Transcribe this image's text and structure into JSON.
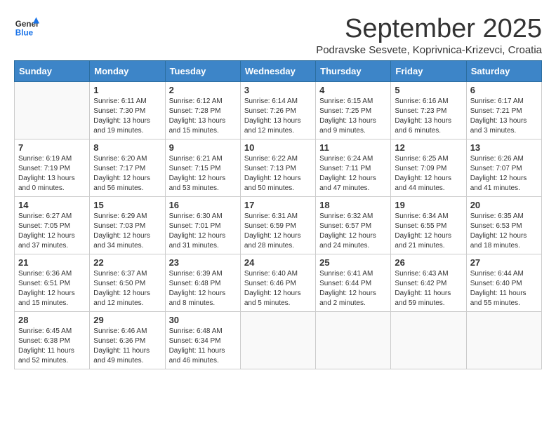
{
  "header": {
    "logo_line1": "General",
    "logo_line2": "Blue",
    "month": "September 2025",
    "location": "Podravske Sesvete, Koprivnica-Krizevci, Croatia"
  },
  "days_of_week": [
    "Sunday",
    "Monday",
    "Tuesday",
    "Wednesday",
    "Thursday",
    "Friday",
    "Saturday"
  ],
  "weeks": [
    [
      {
        "day": "",
        "sunrise": "",
        "sunset": "",
        "daylight": ""
      },
      {
        "day": "1",
        "sunrise": "Sunrise: 6:11 AM",
        "sunset": "Sunset: 7:30 PM",
        "daylight": "Daylight: 13 hours and 19 minutes."
      },
      {
        "day": "2",
        "sunrise": "Sunrise: 6:12 AM",
        "sunset": "Sunset: 7:28 PM",
        "daylight": "Daylight: 13 hours and 15 minutes."
      },
      {
        "day": "3",
        "sunrise": "Sunrise: 6:14 AM",
        "sunset": "Sunset: 7:26 PM",
        "daylight": "Daylight: 13 hours and 12 minutes."
      },
      {
        "day": "4",
        "sunrise": "Sunrise: 6:15 AM",
        "sunset": "Sunset: 7:25 PM",
        "daylight": "Daylight: 13 hours and 9 minutes."
      },
      {
        "day": "5",
        "sunrise": "Sunrise: 6:16 AM",
        "sunset": "Sunset: 7:23 PM",
        "daylight": "Daylight: 13 hours and 6 minutes."
      },
      {
        "day": "6",
        "sunrise": "Sunrise: 6:17 AM",
        "sunset": "Sunset: 7:21 PM",
        "daylight": "Daylight: 13 hours and 3 minutes."
      }
    ],
    [
      {
        "day": "7",
        "sunrise": "Sunrise: 6:19 AM",
        "sunset": "Sunset: 7:19 PM",
        "daylight": "Daylight: 13 hours and 0 minutes."
      },
      {
        "day": "8",
        "sunrise": "Sunrise: 6:20 AM",
        "sunset": "Sunset: 7:17 PM",
        "daylight": "Daylight: 12 hours and 56 minutes."
      },
      {
        "day": "9",
        "sunrise": "Sunrise: 6:21 AM",
        "sunset": "Sunset: 7:15 PM",
        "daylight": "Daylight: 12 hours and 53 minutes."
      },
      {
        "day": "10",
        "sunrise": "Sunrise: 6:22 AM",
        "sunset": "Sunset: 7:13 PM",
        "daylight": "Daylight: 12 hours and 50 minutes."
      },
      {
        "day": "11",
        "sunrise": "Sunrise: 6:24 AM",
        "sunset": "Sunset: 7:11 PM",
        "daylight": "Daylight: 12 hours and 47 minutes."
      },
      {
        "day": "12",
        "sunrise": "Sunrise: 6:25 AM",
        "sunset": "Sunset: 7:09 PM",
        "daylight": "Daylight: 12 hours and 44 minutes."
      },
      {
        "day": "13",
        "sunrise": "Sunrise: 6:26 AM",
        "sunset": "Sunset: 7:07 PM",
        "daylight": "Daylight: 12 hours and 41 minutes."
      }
    ],
    [
      {
        "day": "14",
        "sunrise": "Sunrise: 6:27 AM",
        "sunset": "Sunset: 7:05 PM",
        "daylight": "Daylight: 12 hours and 37 minutes."
      },
      {
        "day": "15",
        "sunrise": "Sunrise: 6:29 AM",
        "sunset": "Sunset: 7:03 PM",
        "daylight": "Daylight: 12 hours and 34 minutes."
      },
      {
        "day": "16",
        "sunrise": "Sunrise: 6:30 AM",
        "sunset": "Sunset: 7:01 PM",
        "daylight": "Daylight: 12 hours and 31 minutes."
      },
      {
        "day": "17",
        "sunrise": "Sunrise: 6:31 AM",
        "sunset": "Sunset: 6:59 PM",
        "daylight": "Daylight: 12 hours and 28 minutes."
      },
      {
        "day": "18",
        "sunrise": "Sunrise: 6:32 AM",
        "sunset": "Sunset: 6:57 PM",
        "daylight": "Daylight: 12 hours and 24 minutes."
      },
      {
        "day": "19",
        "sunrise": "Sunrise: 6:34 AM",
        "sunset": "Sunset: 6:55 PM",
        "daylight": "Daylight: 12 hours and 21 minutes."
      },
      {
        "day": "20",
        "sunrise": "Sunrise: 6:35 AM",
        "sunset": "Sunset: 6:53 PM",
        "daylight": "Daylight: 12 hours and 18 minutes."
      }
    ],
    [
      {
        "day": "21",
        "sunrise": "Sunrise: 6:36 AM",
        "sunset": "Sunset: 6:51 PM",
        "daylight": "Daylight: 12 hours and 15 minutes."
      },
      {
        "day": "22",
        "sunrise": "Sunrise: 6:37 AM",
        "sunset": "Sunset: 6:50 PM",
        "daylight": "Daylight: 12 hours and 12 minutes."
      },
      {
        "day": "23",
        "sunrise": "Sunrise: 6:39 AM",
        "sunset": "Sunset: 6:48 PM",
        "daylight": "Daylight: 12 hours and 8 minutes."
      },
      {
        "day": "24",
        "sunrise": "Sunrise: 6:40 AM",
        "sunset": "Sunset: 6:46 PM",
        "daylight": "Daylight: 12 hours and 5 minutes."
      },
      {
        "day": "25",
        "sunrise": "Sunrise: 6:41 AM",
        "sunset": "Sunset: 6:44 PM",
        "daylight": "Daylight: 12 hours and 2 minutes."
      },
      {
        "day": "26",
        "sunrise": "Sunrise: 6:43 AM",
        "sunset": "Sunset: 6:42 PM",
        "daylight": "Daylight: 11 hours and 59 minutes."
      },
      {
        "day": "27",
        "sunrise": "Sunrise: 6:44 AM",
        "sunset": "Sunset: 6:40 PM",
        "daylight": "Daylight: 11 hours and 55 minutes."
      }
    ],
    [
      {
        "day": "28",
        "sunrise": "Sunrise: 6:45 AM",
        "sunset": "Sunset: 6:38 PM",
        "daylight": "Daylight: 11 hours and 52 minutes."
      },
      {
        "day": "29",
        "sunrise": "Sunrise: 6:46 AM",
        "sunset": "Sunset: 6:36 PM",
        "daylight": "Daylight: 11 hours and 49 minutes."
      },
      {
        "day": "30",
        "sunrise": "Sunrise: 6:48 AM",
        "sunset": "Sunset: 6:34 PM",
        "daylight": "Daylight: 11 hours and 46 minutes."
      },
      {
        "day": "",
        "sunrise": "",
        "sunset": "",
        "daylight": ""
      },
      {
        "day": "",
        "sunrise": "",
        "sunset": "",
        "daylight": ""
      },
      {
        "day": "",
        "sunrise": "",
        "sunset": "",
        "daylight": ""
      },
      {
        "day": "",
        "sunrise": "",
        "sunset": "",
        "daylight": ""
      }
    ]
  ]
}
